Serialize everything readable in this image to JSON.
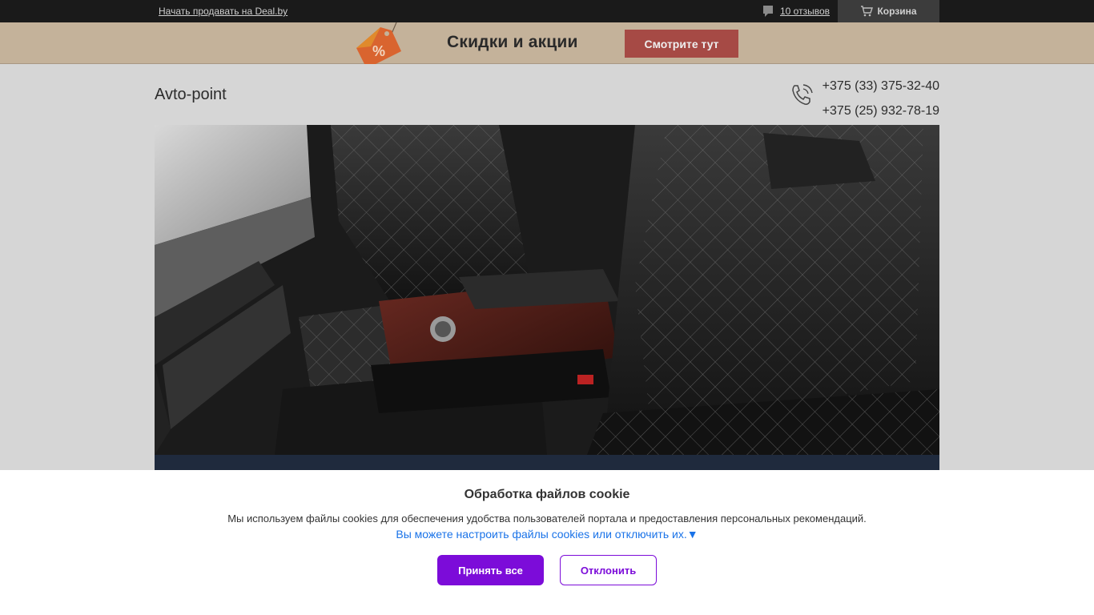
{
  "topbar": {
    "sell_link": "Начать продавать на Deal.by",
    "reviews": "10 отзывов",
    "cart": "Корзина",
    "icons": {
      "reviews": "speech-bubble-icon",
      "cart": "cart-icon"
    }
  },
  "promo": {
    "title": "Скидки и акции",
    "button": "Смотрите тут",
    "tag_symbol": "%",
    "colors": {
      "button": "#a64a45",
      "tag": "#d9642f"
    }
  },
  "header": {
    "shop_name": "Avto-point",
    "phones": [
      "+375 (33) 375-32-40",
      "+375 (25) 932-78-19"
    ],
    "phone_icon": "phone-icon"
  },
  "hero": {
    "image": "car-interior-leather-seats-photo"
  },
  "cookie": {
    "title": "Обработка файлов cookie",
    "text": "Мы используем файлы cookies для обеспечения удобства пользователей портала и предоставления персональных рекомендаций.",
    "settings_link": "Вы можете настроить файлы cookies или отключить их.",
    "settings_arrow": "▼",
    "accept": "Принять все",
    "decline": "Отклонить",
    "colors": {
      "accent": "#7c0cd9",
      "link": "#1a73e8"
    }
  }
}
